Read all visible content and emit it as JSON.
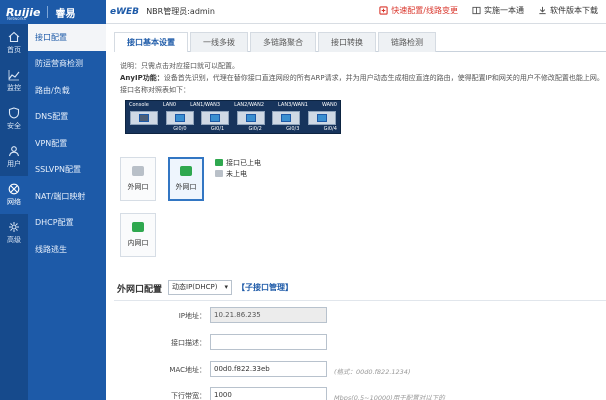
{
  "topbar": {
    "logo": "Ruijie",
    "logo_sub": "Networks",
    "logo_cn": "睿易",
    "product": "eWEB",
    "device_user": "NBR管理员:admin",
    "actions": [
      {
        "label": "快速配置/线路变更",
        "icon": "wizard-icon",
        "alert": true
      },
      {
        "label": "实施一本通",
        "icon": "book-icon",
        "alert": false
      },
      {
        "label": "软件版本下载",
        "icon": "download-icon",
        "alert": false
      }
    ]
  },
  "rail": {
    "items": [
      {
        "label": "首页",
        "icon": "home-icon"
      },
      {
        "label": "监控",
        "icon": "monitor-icon"
      },
      {
        "label": "安全",
        "icon": "shield-icon"
      },
      {
        "label": "用户",
        "icon": "user-icon"
      },
      {
        "label": "网络",
        "icon": "network-icon",
        "active": true
      },
      {
        "label": "高级",
        "icon": "advanced-icon"
      }
    ]
  },
  "submenu": {
    "items": [
      {
        "label": "接口配置",
        "active": true
      },
      {
        "label": "防运营商检测"
      },
      {
        "label": "路由/负载"
      },
      {
        "label": "DNS配置"
      },
      {
        "label": "VPN配置"
      },
      {
        "label": "SSLVPN配置"
      },
      {
        "label": "NAT/端口映射"
      },
      {
        "label": "DHCP配置"
      },
      {
        "label": "线路逃生"
      }
    ]
  },
  "tabs": [
    {
      "label": "接口基本设置",
      "active": true
    },
    {
      "label": "一线多拨"
    },
    {
      "label": "多链路聚合"
    },
    {
      "label": "接口转换"
    },
    {
      "label": "链路检测"
    }
  ],
  "info": {
    "line1": "说明：只需点击对应接口就可以配置。",
    "line2_bold": "AnyIP功能：",
    "line2": "设备首先识别，代理在替你接口直连网段的所有ARP请求，并为用户动态生成相应直连的路由，使得配置IP和网关的用户不修改配置也能上网。",
    "line3": "接口名称对照表如下：",
    "port_labels": [
      "Console",
      "LAN0",
      "LAN1/WAN3",
      "LAN2/WAN2",
      "LAN3/WAN1",
      "WAN0"
    ],
    "port_names": [
      "",
      "Gi0/0",
      "Gi0/1",
      "Gi0/2",
      "Gi0/3",
      "Gi0/4"
    ]
  },
  "selectors": {
    "wan_inner": "外网口",
    "wan_active": "外网口",
    "lan": "内网口"
  },
  "legend": {
    "up": "接口已上电",
    "down": "未上电"
  },
  "config": {
    "title": "外网口配置",
    "mode": "动态IP(DHCP)",
    "sub_link": "【子接口管理】",
    "fields": [
      {
        "label": "IP地址：",
        "value": "10.21.86.235",
        "placeholder": "",
        "hint": "",
        "disabled": true
      },
      {
        "label": "接口描述：",
        "value": "",
        "placeholder": "",
        "hint": "",
        "disabled": false
      },
      {
        "label": "MAC地址：",
        "value": "00d0.f822.33eb",
        "placeholder": "",
        "hint": "(格式：00d0.f822.1234)",
        "disabled": false
      },
      {
        "label": "下行带宽：",
        "value": "1000",
        "placeholder": "",
        "hint": "Mbps(0.5~10000)用于配置对以下的",
        "disabled": false
      }
    ]
  },
  "colors": {
    "primary": "#1d5aa8",
    "rail": "#164a8c",
    "alert": "#d9352b",
    "port_up": "#2fa84f"
  }
}
